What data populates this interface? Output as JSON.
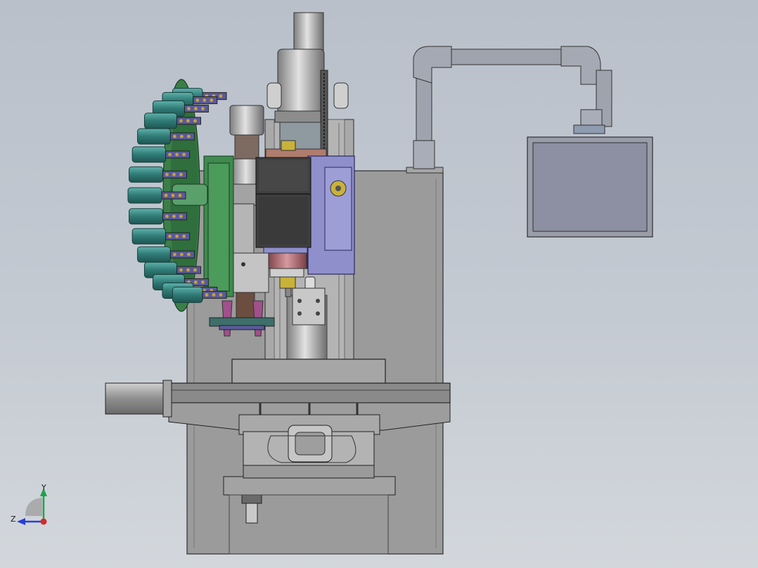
{
  "view": {
    "background_top": "#b9c0ca",
    "background_bottom": "#d3d7dc"
  },
  "colors": {
    "base_gray": "#9a9a9a",
    "steel": "#b8b8b8",
    "dark_steel": "#5f5f5f",
    "head_dark": "#3c3c3c",
    "lavender": "#8f8fcc",
    "magazine_green": "#3f8a4e",
    "tool_teal": "#3d8a86",
    "holder_magenta": "#a0508a",
    "spindle_rose": "#b06b72",
    "yellow": "#c9b23a",
    "monitor_frame": "#9a9da8",
    "monitor_screen": "#8d90a2",
    "arm_gray": "#9fa3ad"
  },
  "triad": {
    "y_label": "Y",
    "z_label": "Z",
    "y_color": "#1fa34a",
    "z_color": "#2a3fd6",
    "origin_color": "#d42a2a"
  }
}
